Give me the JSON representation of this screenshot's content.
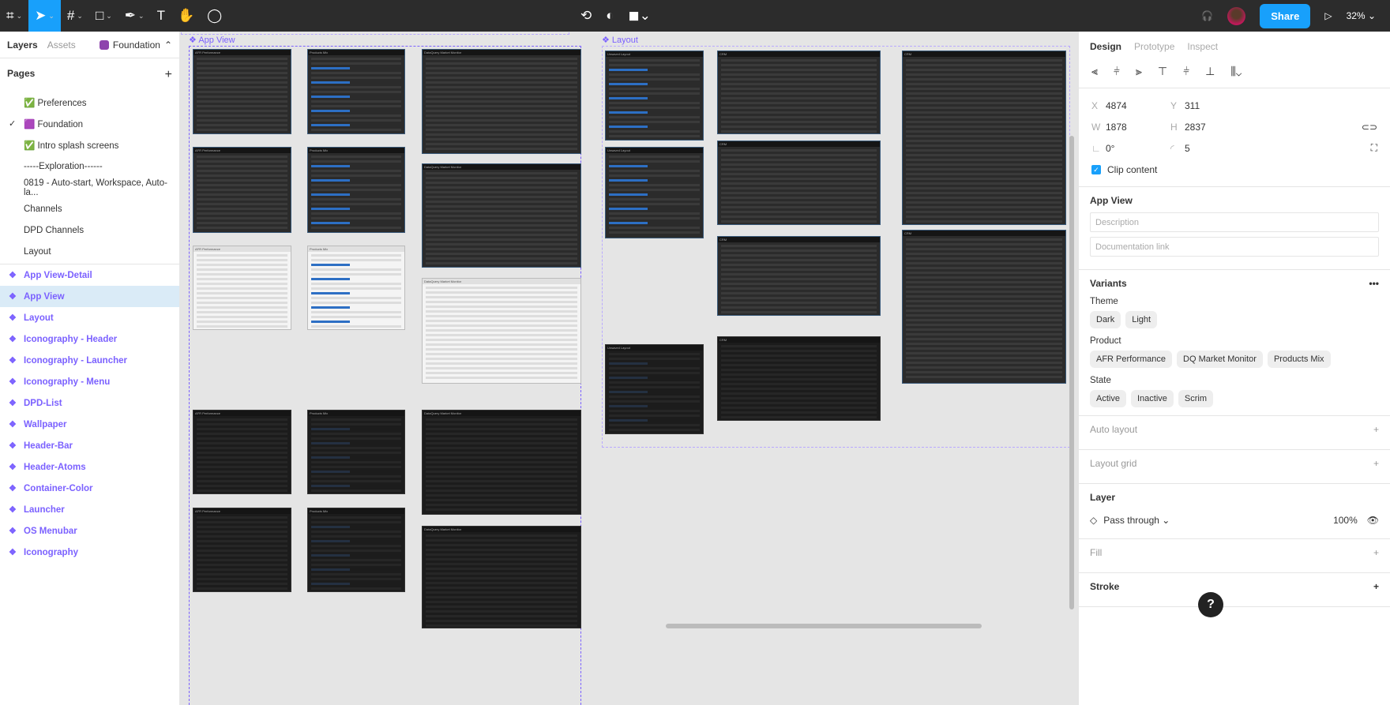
{
  "toolbar": {
    "zoom": "32%",
    "share": "Share",
    "tools": [
      "main-menu",
      "move",
      "frame",
      "rectangle",
      "pen",
      "text",
      "hand",
      "comment"
    ]
  },
  "left": {
    "tab_layers": "Layers",
    "tab_assets": "Assets",
    "page_name": "Foundation",
    "pages_title": "Pages",
    "pages": [
      {
        "label": "✅ Preferences"
      },
      {
        "label": "🟪 Foundation",
        "current": true
      },
      {
        "label": "✅ Intro splash screens"
      },
      {
        "label": "-----Exploration------"
      },
      {
        "label": "0819 - Auto-start, Workspace, Auto-la..."
      },
      {
        "label": "Channels"
      },
      {
        "label": "DPD Channels"
      },
      {
        "label": "Layout"
      }
    ],
    "layers": [
      "App View-Detail",
      "App View",
      "Layout",
      "Iconography - Header",
      "Iconography - Launcher",
      "Iconography - Menu",
      "DPD-List",
      "Wallpaper",
      "Header-Bar",
      "Header-Atoms",
      "Container-Color",
      "Launcher",
      "OS Menubar",
      "Iconography"
    ],
    "selected_layer": "App View"
  },
  "canvas": {
    "frame_app_view": "App View",
    "frame_layout": "Layout",
    "thumb_titles": {
      "afr": "AFR Performance",
      "mix": "Products Mix",
      "dq": "DataQuery Market Monitor",
      "unsaved": "Unsaved Layout",
      "crm": "CRM"
    }
  },
  "right": {
    "tabs": [
      "Design",
      "Prototype",
      "Inspect"
    ],
    "x": "4874",
    "y": "311",
    "w": "1878",
    "h": "2837",
    "rotation": "0°",
    "radius": "5",
    "clip": "Clip content",
    "component_title": "App View",
    "description_ph": "Description",
    "doclink_ph": "Documentation link",
    "variants": "Variants",
    "theme_label": "Theme",
    "theme": [
      "Dark",
      "Light"
    ],
    "product_label": "Product",
    "product": [
      "AFR Performance",
      "DQ Market Monitor",
      "Products Mix"
    ],
    "state_label": "State",
    "state": [
      "Active",
      "Inactive",
      "Scrim"
    ],
    "auto_layout": "Auto layout",
    "layout_grid": "Layout grid",
    "layer": "Layer",
    "blend": "Pass through",
    "opacity": "100%",
    "fill": "Fill",
    "stroke": "Stroke"
  },
  "accent": "#18a0fb",
  "component_color": "#7b61ff"
}
